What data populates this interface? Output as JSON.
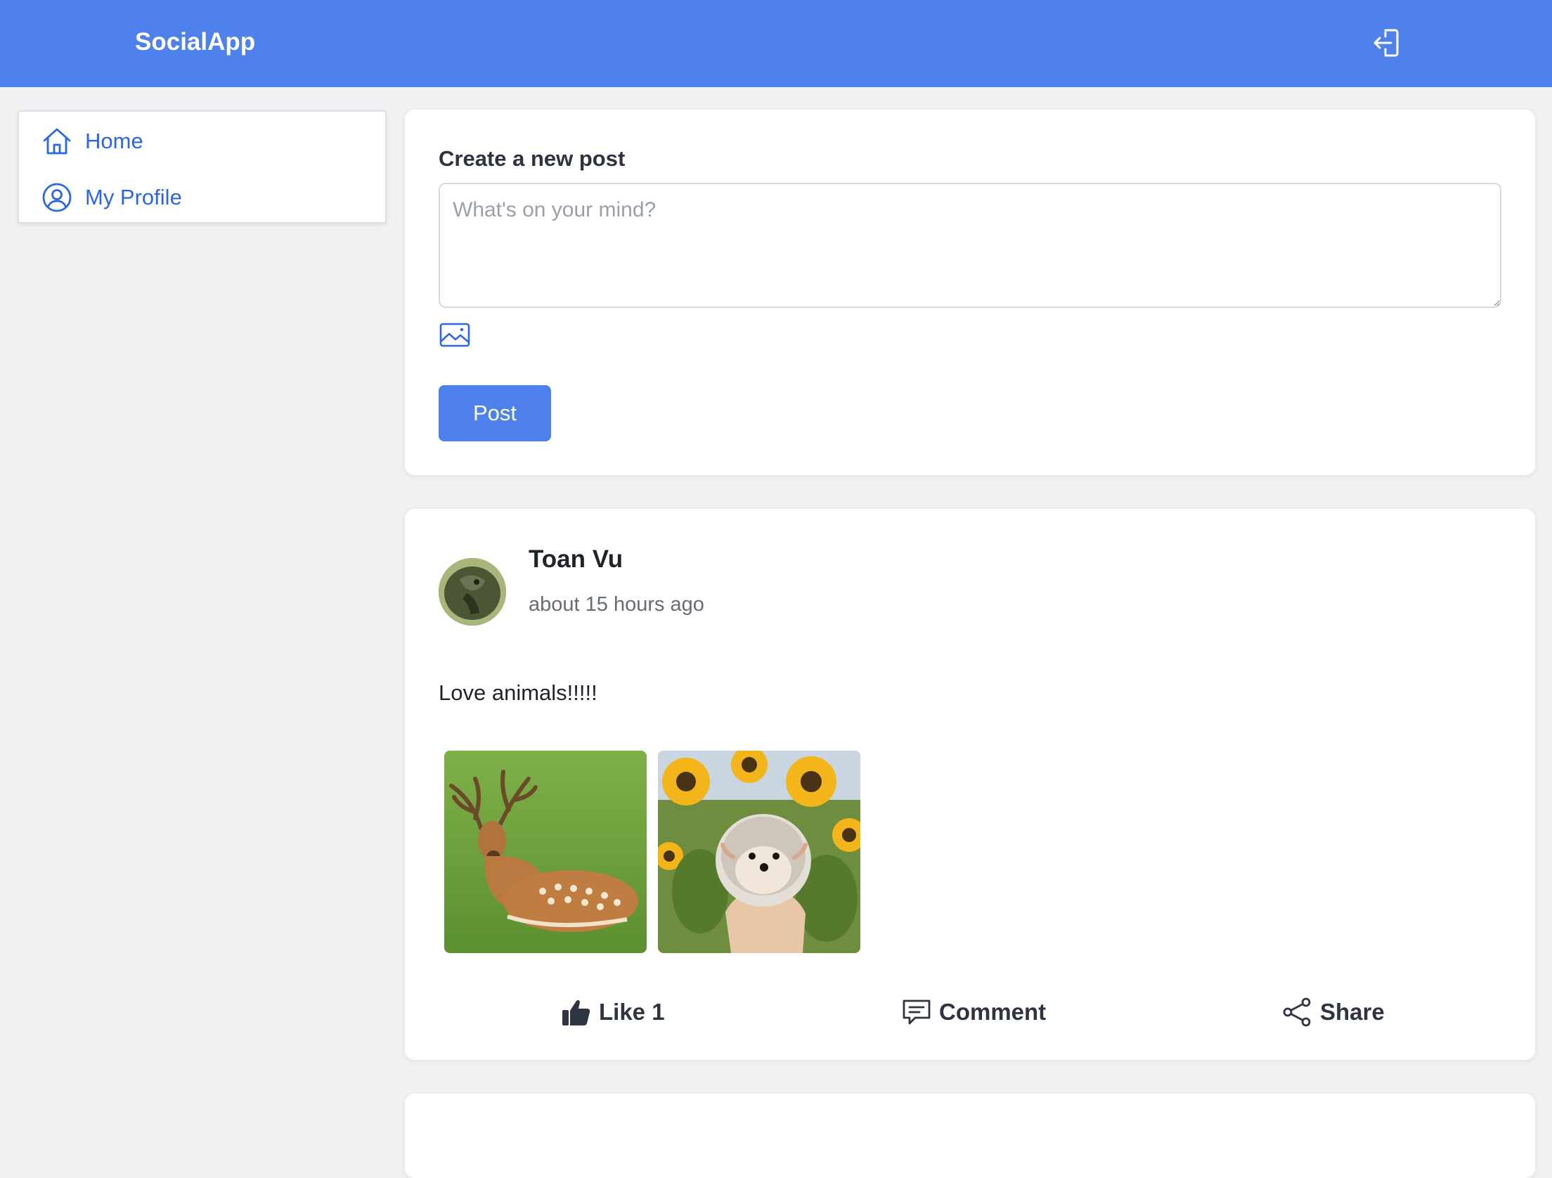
{
  "header": {
    "brand": "SocialApp",
    "logout_icon": "logout-icon",
    "background_color": "#4f81ec"
  },
  "sidebar": {
    "items": [
      {
        "label": "Home",
        "icon": "home-icon"
      },
      {
        "label": "My Profile",
        "icon": "user-circle-icon"
      }
    ],
    "accent_color": "#2c66e8"
  },
  "composer": {
    "title": "Create a new post",
    "placeholder": "What's on your mind?",
    "image_icon": "image-icon",
    "submit_label": "Post"
  },
  "feed": {
    "posts": [
      {
        "author": "Toan Vu",
        "time": "about 15 hours ago",
        "text": "Love animals!!!!!",
        "photos": [
          "deer photo",
          "hedgehog with sunflowers photo"
        ],
        "actions": {
          "like": "Like 1",
          "comment": "Comment",
          "share": "Share"
        }
      }
    ]
  }
}
